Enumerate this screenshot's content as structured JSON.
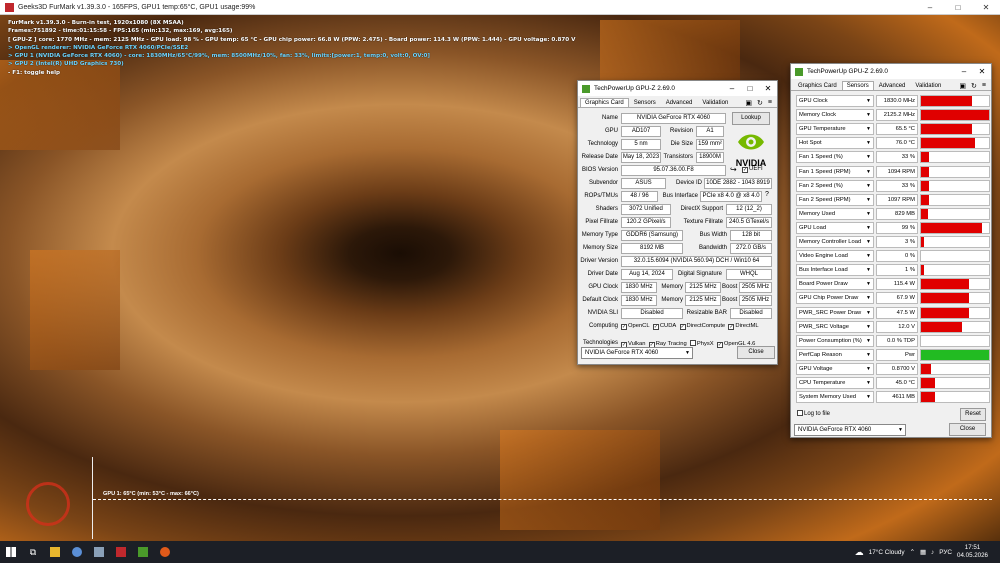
{
  "furmark": {
    "title": "Geeks3D FurMark v1.39.3.0 - 165FPS, GPU1 temp:65°C, GPU1 usage:99%",
    "overlay": [
      "FurMark v1.39.3.0 - Burn-in test, 1920x1080 (8X MSAA)",
      "Frames:751892 - time:01:15:58 - FPS:165 (min:132, max:169, avg:165)",
      "[ GPU-Z ] core: 1770 MHz - mem: 2125 MHz - GPU load: 98 % - GPU temp: 65 °C - GPU chip power: 66.8 W (PPW: 2.475) - Board power: 114.3 W (PPW: 1.444) - GPU voltage: 0.870 V",
      "> OpenGL renderer: NVIDIA GeForce RTX 4060/PCIe/SSE2",
      "> GPU 1 (NVIDIA GeForce RTX 4060) - core: 1830MHz/65°C/99%, mem: 8500MHz/10%, fan: 33%, limits:[power:1, temp:0, volt:0, OV:0]",
      "> GPU 2 (Intel(R) UHD Graphics 730)",
      "- F1: toggle help"
    ],
    "graph_label": "GPU 1: 65°C (min: 53°C - max: 66°C)"
  },
  "gpuz_card": {
    "title": "TechPowerUp GPU-Z 2.69.0",
    "tabs": [
      "Graphics Card",
      "Sensors",
      "Advanced",
      "Validation"
    ],
    "labels": {
      "name": "Name",
      "gpu": "GPU",
      "revision": "Revision",
      "technology": "Technology",
      "die_size": "Die Size",
      "release_date": "Release Date",
      "transistors": "Transistors",
      "bios": "BIOS Version",
      "subvendor": "Subvendor",
      "device_id": "Device ID",
      "rops": "ROPs/TMUs",
      "bus_interface": "Bus Interface",
      "shaders": "Shaders",
      "directx": "DirectX Support",
      "pixel_fillrate": "Pixel Fillrate",
      "texture_fillrate": "Texture Fillrate",
      "memory_type": "Memory Type",
      "bus_width": "Bus Width",
      "memory_size": "Memory Size",
      "bandwidth": "Bandwidth",
      "driver_version": "Driver Version",
      "driver_date": "Driver Date",
      "digital_signature": "Digital Signature",
      "gpu_clock": "GPU Clock",
      "default_clock": "Default Clock",
      "memory": "Memory",
      "boost": "Boost",
      "sli": "NVIDIA SLI",
      "resizable_bar": "Resizable BAR",
      "computing": "Computing",
      "technologies": "Technologies"
    },
    "values": {
      "name": "NVIDIA GeForce RTX 4060",
      "gpu": "AD107",
      "revision": "A1",
      "technology": "5 nm",
      "die_size": "159 mm²",
      "release_date": "May 18, 2023",
      "transistors": "18900M",
      "bios": "95.07.36.00.F8",
      "uefi": "UEFI",
      "subvendor": "ASUS",
      "device_id": "10DE 2882 - 1043 8919",
      "rops": "48 / 96",
      "bus_interface": "PCIe x8 4.0 @ x8 4.0",
      "shaders": "3072 Unified",
      "directx": "12 (12_2)",
      "pixel_fillrate": "120.2 GPixel/s",
      "texture_fillrate": "240.5 GTexel/s",
      "memory_type": "GDDR6 (Samsung)",
      "bus_width": "128 bit",
      "memory_size": "8192 MB",
      "bandwidth": "272.0 GB/s",
      "driver_version": "32.0.15.6094 (NVIDIA 560.94) DCH / Win10 64",
      "driver_date": "Aug 14, 2024",
      "digital_signature": "WHQL",
      "gpu_clock": "1830 MHz",
      "gpu_memory": "2125 MHz",
      "gpu_boost": "2505 MHz",
      "default_clock": "1830 MHz",
      "default_memory": "2125 MHz",
      "default_boost": "2505 MHz",
      "sli": "Disabled",
      "resizable_bar": "Disabled"
    },
    "computing": [
      "OpenCL",
      "CUDA",
      "DirectCompute",
      "DirectML"
    ],
    "technologies": [
      "Vulkan",
      "Ray Tracing",
      "PhysX",
      "OpenGL 4.6"
    ],
    "lookup_label": "Lookup",
    "help_mark": "?",
    "brand": "NVIDIA",
    "selected_gpu": "NVIDIA GeForce RTX 4060",
    "close_label": "Close"
  },
  "gpuz_sensors": {
    "title": "TechPowerUp GPU-Z 2.69.0",
    "tabs": [
      "Graphics Card",
      "Sensors",
      "Advanced",
      "Validation"
    ],
    "rows": [
      {
        "name": "GPU Clock",
        "value": "1830.0 MHz",
        "level": 0.75,
        "color": "#e00000"
      },
      {
        "name": "Memory Clock",
        "value": "2125.2 MHz",
        "level": 1.0,
        "color": "#e00000"
      },
      {
        "name": "GPU Temperature",
        "value": "65.5 °C",
        "level": 0.75,
        "color": "#e00000"
      },
      {
        "name": "Hot Spot",
        "value": "76.0 °C",
        "level": 0.8,
        "color": "#e00000"
      },
      {
        "name": "Fan 1 Speed (%)",
        "value": "33 %",
        "level": 0.12,
        "color": "#e00000"
      },
      {
        "name": "Fan 1 Speed (RPM)",
        "value": "1094 RPM",
        "level": 0.12,
        "color": "#e00000"
      },
      {
        "name": "Fan 2 Speed (%)",
        "value": "33 %",
        "level": 0.12,
        "color": "#e00000"
      },
      {
        "name": "Fan 2 Speed (RPM)",
        "value": "1097 RPM",
        "level": 0.12,
        "color": "#e00000"
      },
      {
        "name": "Memory Used",
        "value": "829 MB",
        "level": 0.1,
        "color": "#e00000"
      },
      {
        "name": "GPU Load",
        "value": "99 %",
        "level": 0.9,
        "color": "#e00000"
      },
      {
        "name": "Memory Controller Load",
        "value": "3 %",
        "level": 0.05,
        "color": "#e00000"
      },
      {
        "name": "Video Engine Load",
        "value": "0 %",
        "level": 0.0,
        "color": "#e00000"
      },
      {
        "name": "Bus Interface Load",
        "value": "1 %",
        "level": 0.05,
        "color": "#e00000"
      },
      {
        "name": "Board Power Draw",
        "value": "115.4 W",
        "level": 0.7,
        "color": "#e00000"
      },
      {
        "name": "GPU Chip Power Draw",
        "value": "67.9 W",
        "level": 0.7,
        "color": "#e00000"
      },
      {
        "name": "PWR_SRC Power Draw",
        "value": "47.5 W",
        "level": 0.7,
        "color": "#e00000"
      },
      {
        "name": "PWR_SRC Voltage",
        "value": "12.0 V",
        "level": 0.6,
        "color": "#e00000"
      },
      {
        "name": "Power Consumption (%)",
        "value": "0.0 % TDP",
        "level": 0.0,
        "color": "#e00000"
      },
      {
        "name": "PerfCap Reason",
        "value": "Pwr",
        "level": 1.0,
        "color": "#22bb22"
      },
      {
        "name": "GPU Voltage",
        "value": "0.8700 V",
        "level": 0.15,
        "color": "#e00000"
      },
      {
        "name": "CPU Temperature",
        "value": "45.0 °C",
        "level": 0.2,
        "color": "#e00000"
      },
      {
        "name": "System Memory Used",
        "value": "4611 MB",
        "level": 0.2,
        "color": "#e00000"
      }
    ],
    "log_label": "Log to file",
    "reset_label": "Reset",
    "selected_gpu": "NVIDIA GeForce RTX 4060",
    "close_label": "Close"
  },
  "taskbar": {
    "weather": "17°C  Cloudy",
    "lang": "РУС",
    "time": "17:51",
    "date": "04.05.2026"
  }
}
